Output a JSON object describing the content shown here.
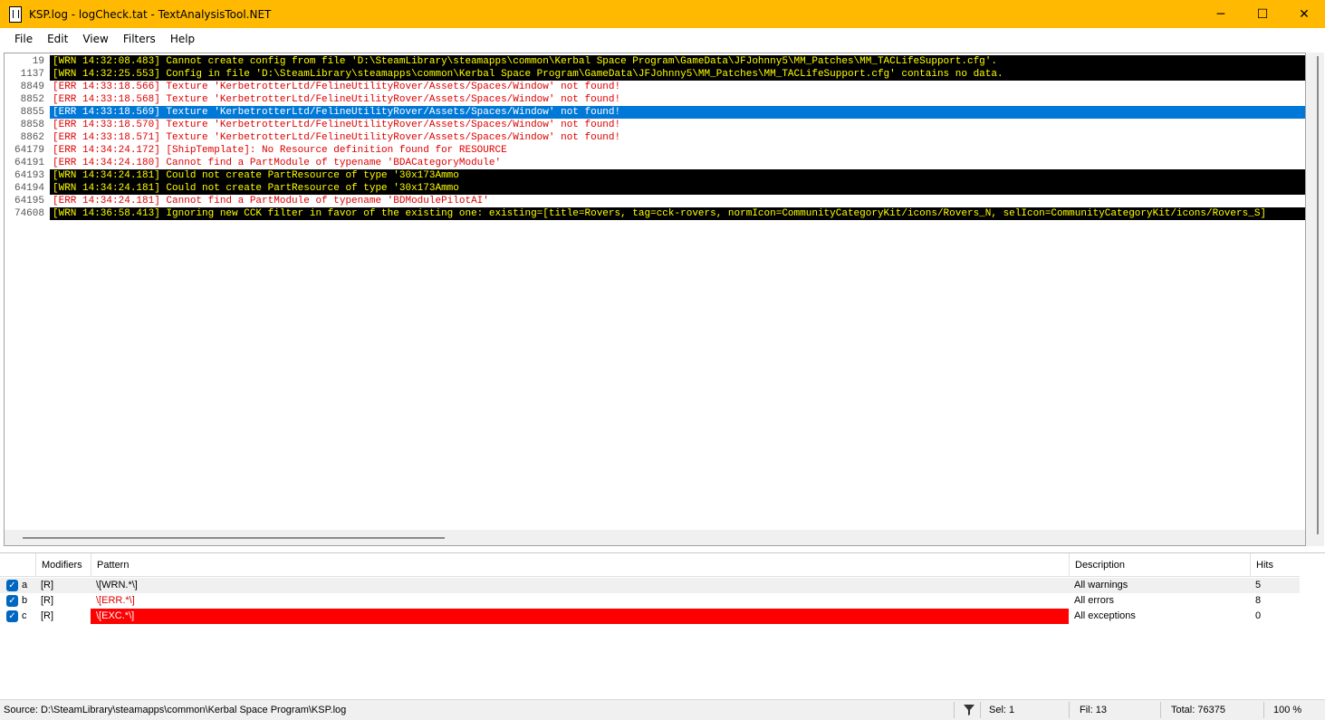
{
  "window": {
    "title": "KSP.log - logCheck.tat - TextAnalysisTool.NET",
    "minimize": "─",
    "maximize": "☐",
    "close": "✕"
  },
  "menu": [
    "File",
    "Edit",
    "View",
    "Filters",
    "Help"
  ],
  "log": [
    {
      "line": "19",
      "text": "[WRN 14:32:08.483] Cannot create config from file 'D:\\SteamLibrary\\steamapps\\common\\Kerbal Space Program\\GameData\\JFJohnny5\\MM_Patches\\MM_TACLifeSupport.cfg'.",
      "kind": "wrn"
    },
    {
      "line": "1137",
      "text": "[WRN 14:32:25.553] Config in file 'D:\\SteamLibrary\\steamapps\\common\\Kerbal Space Program\\GameData\\JFJohnny5\\MM_Patches\\MM_TACLifeSupport.cfg' contains no data.",
      "kind": "wrn"
    },
    {
      "line": "8849",
      "text": "[ERR 14:33:18.566] Texture 'KerbetrotterLtd/FelineUtilityRover/Assets/Spaces/Window' not found!",
      "kind": "err"
    },
    {
      "line": "8852",
      "text": "[ERR 14:33:18.568] Texture 'KerbetrotterLtd/FelineUtilityRover/Assets/Spaces/Window' not found!",
      "kind": "err"
    },
    {
      "line": "8855",
      "text": "[ERR 14:33:18.569] Texture 'KerbetrotterLtd/FelineUtilityRover/Assets/Spaces/Window' not found!",
      "kind": "sel"
    },
    {
      "line": "8858",
      "text": "[ERR 14:33:18.570] Texture 'KerbetrotterLtd/FelineUtilityRover/Assets/Spaces/Window' not found!",
      "kind": "err"
    },
    {
      "line": "8862",
      "text": "[ERR 14:33:18.571] Texture 'KerbetrotterLtd/FelineUtilityRover/Assets/Spaces/Window' not found!",
      "kind": "err"
    },
    {
      "line": "64179",
      "text": "[ERR 14:34:24.172] [ShipTemplate]: No Resource definition found for RESOURCE",
      "kind": "err"
    },
    {
      "line": "64191",
      "text": "[ERR 14:34:24.180] Cannot find a PartModule of typename 'BDACategoryModule'",
      "kind": "err"
    },
    {
      "line": "64193",
      "text": "[WRN 14:34:24.181] Could not create PartResource of type '30x173Ammo",
      "kind": "wrn"
    },
    {
      "line": "64194",
      "text": "[WRN 14:34:24.181] Could not create PartResource of type '30x173Ammo",
      "kind": "wrn"
    },
    {
      "line": "64195",
      "text": "[ERR 14:34:24.181] Cannot find a PartModule of typename 'BDModulePilotAI'",
      "kind": "err"
    },
    {
      "line": "74608",
      "text": "[WRN 14:36:58.413] Ignoring new CCK filter in favor of the existing one: existing=[title=Rovers, tag=cck-rovers, normIcon=CommunityCategoryKit/icons/Rovers_N, selIcon=CommunityCategoryKit/icons/Rovers_S]",
      "kind": "wrn"
    }
  ],
  "filters": {
    "headers": {
      "modifiers": "Modifiers",
      "pattern": "Pattern",
      "description": "Description",
      "hits": "Hits"
    },
    "rows": [
      {
        "letter": "a",
        "modifiers": "[R]",
        "pattern": "\\[WRN.*\\]",
        "description": "All warnings",
        "hits": "5",
        "pattern_color": "#000000",
        "pattern_bg": "#f0f0f0"
      },
      {
        "letter": "b",
        "modifiers": "[R]",
        "pattern": "\\[ERR.*\\]",
        "description": "All errors",
        "hits": "8",
        "pattern_color": "#e00000",
        "pattern_bg": "#ffffff"
      },
      {
        "letter": "c",
        "modifiers": "[R]",
        "pattern": "\\[EXC.*\\]",
        "description": "All exceptions",
        "hits": "0",
        "pattern_color": "#ffffff",
        "pattern_bg": "#ff0000"
      }
    ]
  },
  "status": {
    "source": "Source: D:\\SteamLibrary\\steamapps\\common\\Kerbal Space Program\\KSP.log",
    "sel": "Sel: 1",
    "fil": "Fil: 13",
    "total": "Total: 76375",
    "zoom": "100 %"
  },
  "colors": {
    "titlebar": "#ffb900",
    "selection": "#0078d7",
    "warning_bg": "#000000",
    "warning_fg": "#ffff00",
    "error_fg": "#e00000"
  }
}
